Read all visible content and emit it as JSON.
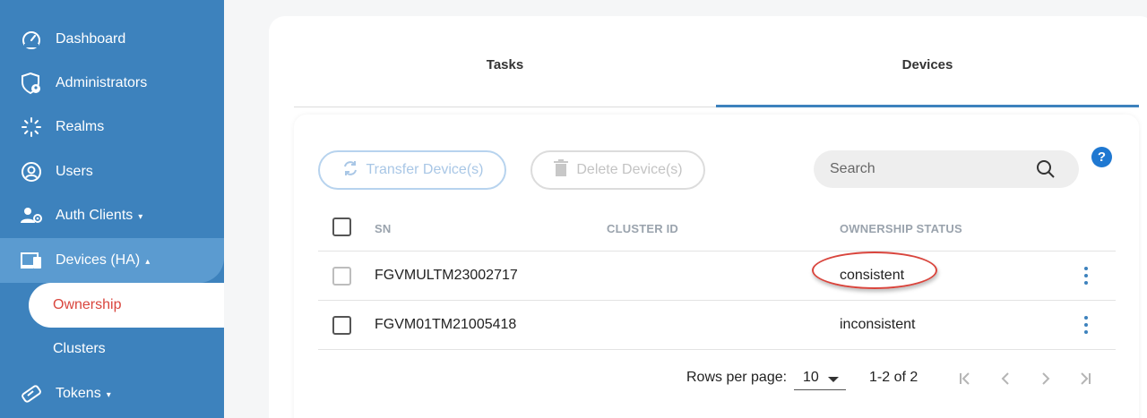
{
  "sidebar": {
    "items": [
      {
        "label": "Dashboard",
        "icon": "speedometer-icon"
      },
      {
        "label": "Administrators",
        "icon": "shield-user-icon"
      },
      {
        "label": "Realms",
        "icon": "spinner-icon"
      },
      {
        "label": "Users",
        "icon": "user-circle-icon"
      },
      {
        "label": "Auth Clients",
        "icon": "users-gear-icon",
        "caret": "▾"
      },
      {
        "label": "Devices (HA)",
        "icon": "devices-icon",
        "caret": "▴"
      },
      {
        "label": "Tokens",
        "icon": "token-icon",
        "caret": "▾"
      }
    ],
    "subitems": [
      {
        "label": "Ownership",
        "active": true
      },
      {
        "label": "Clusters",
        "active": false
      }
    ]
  },
  "tabs": [
    {
      "label": "Tasks",
      "active": false
    },
    {
      "label": "Devices",
      "active": true
    }
  ],
  "toolbar": {
    "transfer_label": "Transfer Device(s)",
    "delete_label": "Delete Device(s)",
    "search_placeholder": "Search",
    "help_label": "?"
  },
  "table": {
    "columns": [
      "SN",
      "CLUSTER ID",
      "OWNERSHIP STATUS"
    ],
    "rows": [
      {
        "sn": "FGVMULTM23002717",
        "cluster_id": "",
        "status": "consistent"
      },
      {
        "sn": "FGVM01TM21005418",
        "cluster_id": "",
        "status": "inconsistent"
      }
    ]
  },
  "pagination": {
    "rows_per_page_label": "Rows per page:",
    "rows_per_page": "10",
    "range": "1-2 of 2"
  },
  "colors": {
    "sidebar": "#3d82bd",
    "sidebar_active": "#5b9bd0",
    "accent": "#3d82bd",
    "active_subitem_text": "#d9453d",
    "highlight": "#d9453d"
  }
}
